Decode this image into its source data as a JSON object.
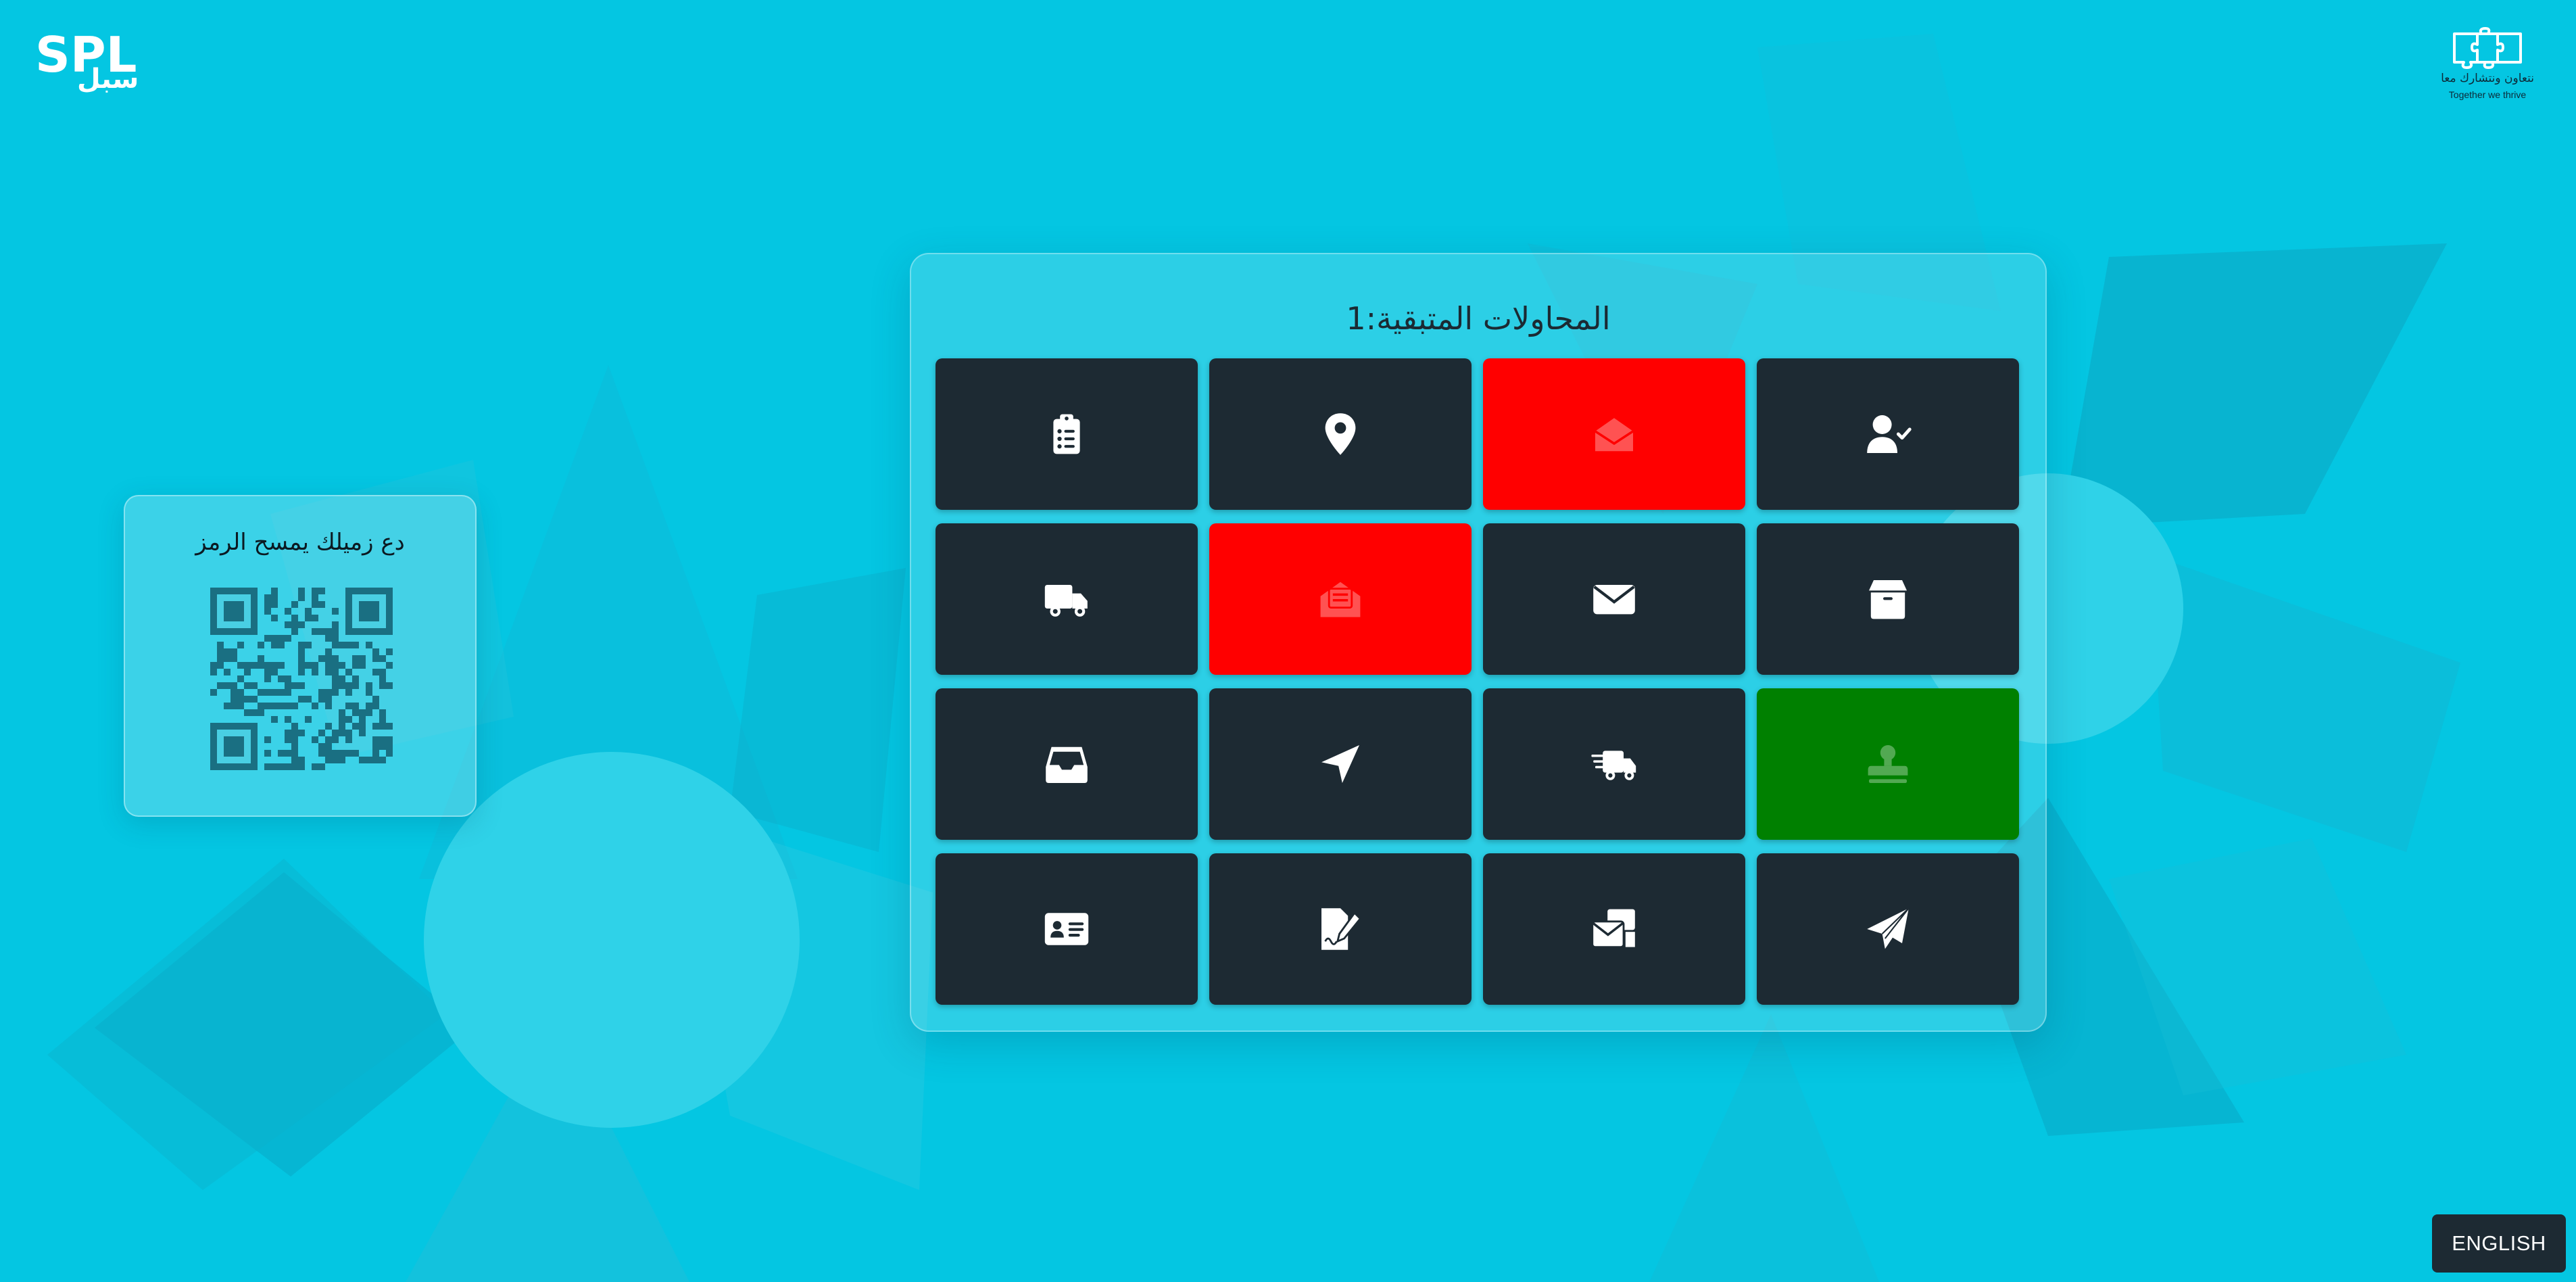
{
  "header": {
    "logo_text": "SPL",
    "logo_arabic": "سبل",
    "partner_arabic": "نتعاون ونتشارك معا",
    "partner_english": "Together we thrive"
  },
  "qr_card": {
    "title": "دع زميلك يمسح الرمز"
  },
  "game": {
    "attempts_label": "المحاولات المتبقية:",
    "attempts_value": "1",
    "tiles": [
      {
        "icon": "clipboard-list-icon",
        "state": "hidden"
      },
      {
        "icon": "location-pin-icon",
        "state": "hidden"
      },
      {
        "icon": "envelope-open-icon",
        "state": "wrong"
      },
      {
        "icon": "user-check-icon",
        "state": "hidden"
      },
      {
        "icon": "delivery-truck-icon",
        "state": "hidden"
      },
      {
        "icon": "envelope-open-text-icon",
        "state": "wrong"
      },
      {
        "icon": "envelope-icon",
        "state": "hidden"
      },
      {
        "icon": "package-box-icon",
        "state": "hidden"
      },
      {
        "icon": "inbox-tray-icon",
        "state": "hidden"
      },
      {
        "icon": "location-arrow-icon",
        "state": "hidden"
      },
      {
        "icon": "fast-truck-icon",
        "state": "hidden"
      },
      {
        "icon": "stamp-icon",
        "state": "correct"
      },
      {
        "icon": "id-card-icon",
        "state": "hidden"
      },
      {
        "icon": "file-signature-icon",
        "state": "hidden"
      },
      {
        "icon": "envelopes-bulk-icon",
        "state": "hidden"
      },
      {
        "icon": "paper-plane-icon",
        "state": "hidden"
      }
    ]
  },
  "footer": {
    "language_button": "ENGLISH"
  },
  "colors": {
    "background": "#04c6e2",
    "tile": "#1d2a33",
    "wrong": "#ff0000",
    "correct": "#008000"
  }
}
